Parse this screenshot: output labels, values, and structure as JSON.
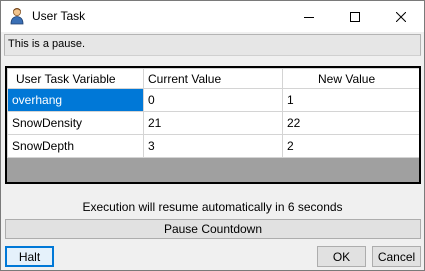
{
  "window": {
    "title": "User Task",
    "icon": "user-person-icon"
  },
  "message": "This is a pause.",
  "grid": {
    "headers": [
      "User Task Variable",
      "Current Value",
      "New Value"
    ],
    "rows": [
      {
        "variable": "overhang",
        "current": "0",
        "new": "1",
        "selected": true
      },
      {
        "variable": "SnowDensity",
        "current": "21",
        "new": "22"
      },
      {
        "variable": "SnowDepth",
        "current": "3",
        "new": "2"
      }
    ]
  },
  "status_text": "Execution will resume automatically in 6 seconds",
  "buttons": {
    "pause_countdown": "Pause Countdown",
    "halt": "Halt",
    "ok": "OK",
    "cancel": "Cancel"
  },
  "colors": {
    "selection": "#0078d7",
    "focus_border": "#0078d7"
  }
}
